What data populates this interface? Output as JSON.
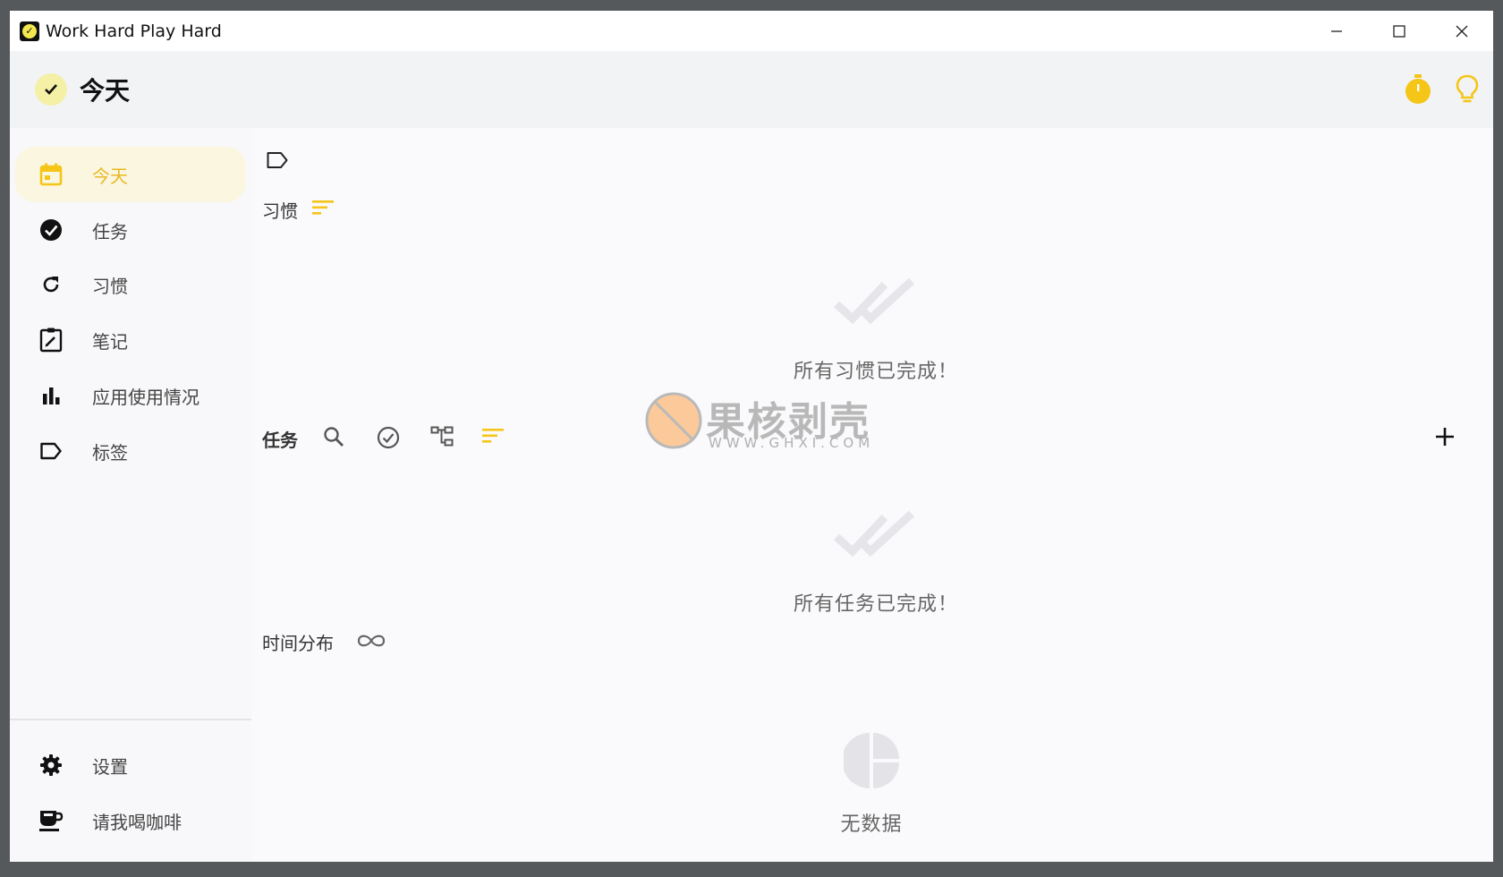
{
  "window": {
    "title": "Work Hard Play Hard",
    "controls": [
      "minimize",
      "maximize",
      "close"
    ]
  },
  "header": {
    "title": "今天",
    "right_icons": [
      "timer-icon",
      "lightbulb-icon"
    ]
  },
  "sidebar": {
    "items": [
      {
        "label": "今天",
        "icon": "calendar-icon",
        "active": true
      },
      {
        "label": "任务",
        "icon": "check-circle-icon"
      },
      {
        "label": "习惯",
        "icon": "refresh-icon"
      },
      {
        "label": "笔记",
        "icon": "clipboard-edit-icon"
      },
      {
        "label": "应用使用情况",
        "icon": "bar-chart-icon"
      },
      {
        "label": "标签",
        "icon": "tag-icon"
      }
    ],
    "bottom_items": [
      {
        "label": "设置",
        "icon": "gear-icon"
      },
      {
        "label": "请我喝咖啡",
        "icon": "coffee-icon"
      }
    ]
  },
  "main": {
    "habits": {
      "title": "习惯",
      "empty_text": "所有习惯已完成！"
    },
    "tasks": {
      "title": "任务",
      "empty_text": "所有任务已完成！"
    },
    "time_distribution": {
      "title": "时间分布",
      "empty_text": "无数据"
    }
  },
  "watermark": {
    "text": "果核剥壳",
    "url": "WWW.GHXI.COM"
  },
  "colors": {
    "accent": "#f5c518",
    "active_bg": "#fbf6df",
    "header_bg": "#f2f3f5",
    "frame": "#56595c"
  }
}
